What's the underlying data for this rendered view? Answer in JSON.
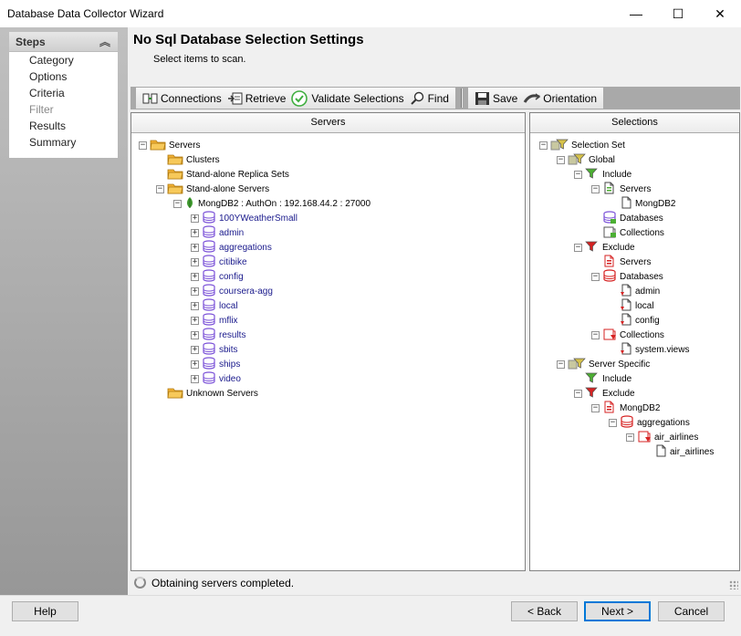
{
  "window": {
    "title": "Database Data Collector Wizard",
    "minimize": "—",
    "maximize": "☐",
    "close": "✕"
  },
  "steps": {
    "heading": "Steps",
    "items": [
      {
        "label": "Category",
        "enabled": true
      },
      {
        "label": "Options",
        "enabled": true
      },
      {
        "label": "Criteria",
        "enabled": true
      },
      {
        "label": "Filter",
        "enabled": false
      },
      {
        "label": "Results",
        "enabled": true
      },
      {
        "label": "Summary",
        "enabled": true
      }
    ]
  },
  "header": {
    "title": "No Sql Database Selection Settings",
    "subtitle": "Select items to scan."
  },
  "toolbar": {
    "connections": "Connections",
    "retrieve": "Retrieve",
    "validate": "Validate Selections",
    "find": "Find",
    "save": "Save",
    "orientation": "Orientation"
  },
  "servers_panel": {
    "title": "Servers",
    "nodes": [
      {
        "label": "Servers",
        "level": 0,
        "icon": "folder",
        "expander": "minus"
      },
      {
        "label": "Clusters",
        "level": 1,
        "icon": "folder",
        "expander": "none"
      },
      {
        "label": "Stand-alone Replica Sets",
        "level": 1,
        "icon": "folder",
        "expander": "none"
      },
      {
        "label": "Stand-alone Servers",
        "level": 1,
        "icon": "folder",
        "expander": "minus"
      },
      {
        "label": "MongDB2 : AuthOn : 192.168.44.2 : 27000",
        "level": 2,
        "icon": "mongo-leaf",
        "expander": "minus"
      },
      {
        "label": "100YWeatherSmall",
        "level": 3,
        "icon": "database",
        "expander": "plus"
      },
      {
        "label": "admin",
        "level": 3,
        "icon": "database",
        "expander": "plus"
      },
      {
        "label": "aggregations",
        "level": 3,
        "icon": "database",
        "expander": "plus"
      },
      {
        "label": "citibike",
        "level": 3,
        "icon": "database",
        "expander": "plus"
      },
      {
        "label": "config",
        "level": 3,
        "icon": "database",
        "expander": "plus"
      },
      {
        "label": "coursera-agg",
        "level": 3,
        "icon": "database",
        "expander": "plus"
      },
      {
        "label": "local",
        "level": 3,
        "icon": "database",
        "expander": "plus"
      },
      {
        "label": "mflix",
        "level": 3,
        "icon": "database",
        "expander": "plus"
      },
      {
        "label": "results",
        "level": 3,
        "icon": "database",
        "expander": "plus"
      },
      {
        "label": "sbits",
        "level": 3,
        "icon": "database",
        "expander": "plus"
      },
      {
        "label": "ships",
        "level": 3,
        "icon": "database",
        "expander": "plus"
      },
      {
        "label": "video",
        "level": 3,
        "icon": "database",
        "expander": "plus"
      },
      {
        "label": "Unknown Servers",
        "level": 1,
        "icon": "folder",
        "expander": "none"
      }
    ]
  },
  "selections_panel": {
    "title": "Selections",
    "nodes": [
      {
        "label": "Selection Set",
        "level": 0,
        "icon": "filter-set",
        "expander": "minus"
      },
      {
        "label": "Global",
        "level": 1,
        "icon": "filter-set",
        "expander": "minus"
      },
      {
        "label": "Include",
        "level": 2,
        "icon": "filter-include",
        "expander": "minus"
      },
      {
        "label": "Servers",
        "level": 3,
        "icon": "doc-include",
        "expander": "minus"
      },
      {
        "label": "MongDB2",
        "level": 4,
        "icon": "doc",
        "expander": "none"
      },
      {
        "label": "Databases",
        "level": 3,
        "icon": "db-include",
        "expander": "none"
      },
      {
        "label": "Collections",
        "level": 3,
        "icon": "coll-include",
        "expander": "none"
      },
      {
        "label": "Exclude",
        "level": 2,
        "icon": "filter-exclude",
        "expander": "minus"
      },
      {
        "label": "Servers",
        "level": 3,
        "icon": "doc-exclude",
        "expander": "none"
      },
      {
        "label": "Databases",
        "level": 3,
        "icon": "db-exclude",
        "expander": "minus"
      },
      {
        "label": "admin",
        "level": 4,
        "icon": "doc-red",
        "expander": "none"
      },
      {
        "label": "local",
        "level": 4,
        "icon": "doc-red",
        "expander": "none"
      },
      {
        "label": "config",
        "level": 4,
        "icon": "doc-red",
        "expander": "none"
      },
      {
        "label": "Collections",
        "level": 3,
        "icon": "coll-exclude",
        "expander": "minus"
      },
      {
        "label": "system.views",
        "level": 4,
        "icon": "doc-red",
        "expander": "none"
      },
      {
        "label": "Server Specific",
        "level": 1,
        "icon": "filter-set",
        "expander": "minus"
      },
      {
        "label": "Include",
        "level": 2,
        "icon": "filter-include",
        "expander": "none"
      },
      {
        "label": "Exclude",
        "level": 2,
        "icon": "filter-exclude",
        "expander": "minus"
      },
      {
        "label": "MongDB2",
        "level": 3,
        "icon": "doc-exclude",
        "expander": "minus"
      },
      {
        "label": "aggregations",
        "level": 4,
        "icon": "db-exclude",
        "expander": "minus"
      },
      {
        "label": "air_airlines",
        "level": 5,
        "icon": "coll-exclude",
        "expander": "minus"
      },
      {
        "label": "air_airlines",
        "level": 6,
        "icon": "doc",
        "expander": "none"
      }
    ]
  },
  "status": {
    "text": "Obtaining servers completed."
  },
  "buttons": {
    "help": "Help",
    "back": "< Back",
    "next": "Next >",
    "cancel": "Cancel"
  },
  "colors": {
    "accent": "#0078d7",
    "folder": "#f2b134",
    "database": "#7b52d8",
    "mongo": "#3f9a2e",
    "include": "#4caf33",
    "exclude": "#d62222"
  }
}
